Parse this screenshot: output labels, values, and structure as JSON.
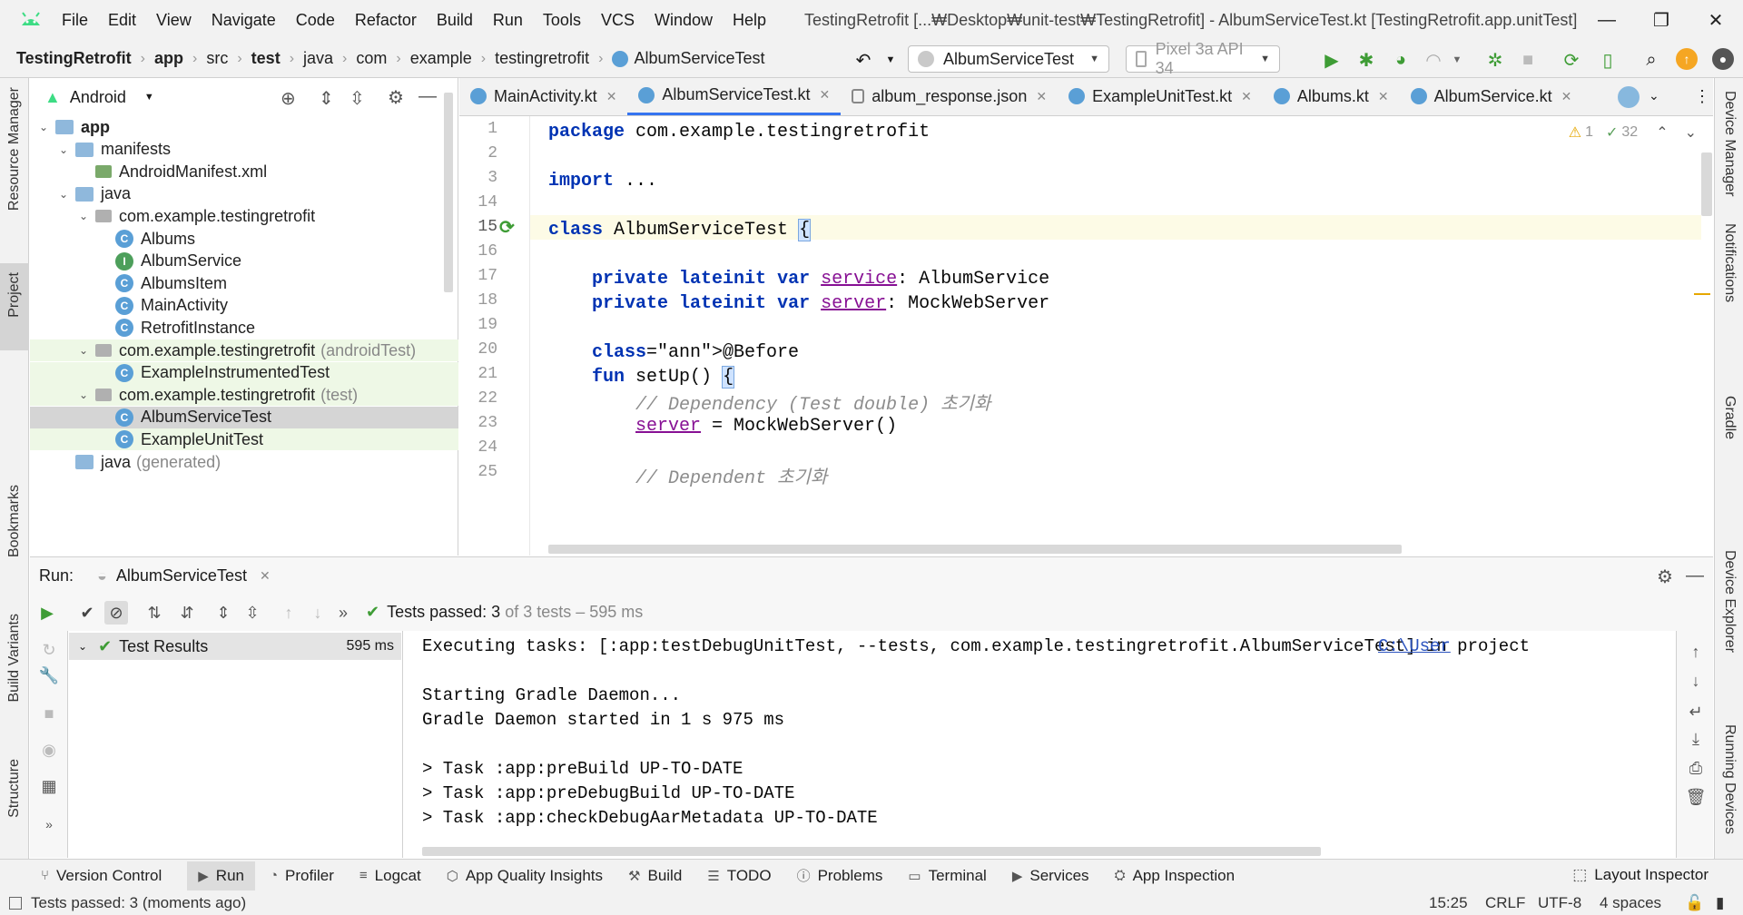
{
  "app": {
    "title": "TestingRetrofit [...₩Desktop₩unit-test₩TestingRetrofit] - AlbumServiceTest.kt [TestingRetrofit.app.unitTest]"
  },
  "menu": [
    "File",
    "Edit",
    "View",
    "Navigate",
    "Code",
    "Refactor",
    "Build",
    "Run",
    "Tools",
    "VCS",
    "Window",
    "Help"
  ],
  "breadcrumb": [
    "TestingRetrofit",
    "app",
    "src",
    "test",
    "java",
    "com",
    "example",
    "testingretrofit",
    "AlbumServiceTest"
  ],
  "run_config": "AlbumServiceTest",
  "device": "Pixel 3a API 34",
  "left_strip": [
    "Resource Manager",
    "Project",
    "Bookmarks",
    "Build Variants",
    "Structure"
  ],
  "right_strip": [
    "Device Manager",
    "Notifications",
    "Gradle",
    "Device Explorer",
    "Running Devices"
  ],
  "project_panel": {
    "view": "Android",
    "tree": [
      {
        "label": "app",
        "bold": true,
        "level": 0,
        "type": "module",
        "expanded": true
      },
      {
        "label": "manifests",
        "level": 1,
        "type": "folder",
        "expanded": true
      },
      {
        "label": "AndroidManifest.xml",
        "level": 2,
        "type": "manifest"
      },
      {
        "label": "java",
        "level": 1,
        "type": "folder",
        "expanded": true
      },
      {
        "label": "com.example.testingretrofit",
        "level": 2,
        "type": "package",
        "expanded": true
      },
      {
        "label": "Albums",
        "level": 3,
        "type": "class"
      },
      {
        "label": "AlbumService",
        "level": 3,
        "type": "interface"
      },
      {
        "label": "AlbumsItem",
        "level": 3,
        "type": "class"
      },
      {
        "label": "MainActivity",
        "level": 3,
        "type": "class"
      },
      {
        "label": "RetrofitInstance",
        "level": 3,
        "type": "class"
      },
      {
        "label": "com.example.testingretrofit",
        "suffix": "(androidTest)",
        "level": 2,
        "type": "package",
        "expanded": true,
        "green": true
      },
      {
        "label": "ExampleInstrumentedTest",
        "level": 3,
        "type": "class",
        "green": true
      },
      {
        "label": "com.example.testingretrofit",
        "suffix": "(test)",
        "level": 2,
        "type": "package",
        "expanded": true,
        "green": true
      },
      {
        "label": "AlbumServiceTest",
        "level": 3,
        "type": "class",
        "selected": true
      },
      {
        "label": "ExampleUnitTest",
        "level": 3,
        "type": "class",
        "green": true
      },
      {
        "label": "java",
        "suffix": "(generated)",
        "level": 1,
        "type": "genfolder"
      }
    ]
  },
  "editor_tabs": [
    {
      "label": "MainActivity.kt",
      "active": false
    },
    {
      "label": "AlbumServiceTest.kt",
      "active": true
    },
    {
      "label": "album_response.json",
      "active": false
    },
    {
      "label": "ExampleUnitTest.kt",
      "active": false
    },
    {
      "label": "Albums.kt",
      "active": false
    },
    {
      "label": "AlbumService.kt",
      "active": false
    }
  ],
  "inspections": {
    "warnings": "1",
    "weak": "32"
  },
  "code_lines": [
    {
      "n": "1",
      "t": "package com.example.testingretrofit"
    },
    {
      "n": "2",
      "t": ""
    },
    {
      "n": "3",
      "t": "import ..."
    },
    {
      "n": "14",
      "t": ""
    },
    {
      "n": "15",
      "t": "class AlbumServiceTest {"
    },
    {
      "n": "16",
      "t": ""
    },
    {
      "n": "17",
      "t": "    private lateinit var service: AlbumService"
    },
    {
      "n": "18",
      "t": "    private lateinit var server: MockWebServer"
    },
    {
      "n": "19",
      "t": ""
    },
    {
      "n": "20",
      "t": "    @Before"
    },
    {
      "n": "21",
      "t": "    fun setUp() {"
    },
    {
      "n": "22",
      "t": "        // Dependency (Test double) 초기화"
    },
    {
      "n": "23",
      "t": "        server = MockWebServer()"
    },
    {
      "n": "24",
      "t": ""
    },
    {
      "n": "25",
      "t": "        // Dependent 초기화"
    }
  ],
  "run": {
    "label": "Run:",
    "config": "AlbumServiceTest",
    "status_prefix": "Tests passed:",
    "passed": "3",
    "status_suffix": "of 3 tests – 595 ms",
    "tree": {
      "label": "Test Results",
      "time": "595 ms"
    },
    "console": [
      "Executing tasks: [:app:testDebugUnitTest, --tests, com.example.testingretrofit.AlbumServiceTest] in project ",
      "",
      "Starting Gradle Daemon...",
      "Gradle Daemon started in 1 s 975 ms",
      "",
      "> Task :app:preBuild UP-TO-DATE",
      "> Task :app:preDebugBuild UP-TO-DATE",
      "> Task :app:checkDebugAarMetadata UP-TO-DATE"
    ],
    "console_link": "C:\\User"
  },
  "tool_windows": [
    "Version Control",
    "Run",
    "Profiler",
    "Logcat",
    "App Quality Insights",
    "Build",
    "TODO",
    "Problems",
    "Terminal",
    "Services",
    "App Inspection"
  ],
  "layout_inspector": "Layout Inspector",
  "status": {
    "message": "Tests passed: 3 (moments ago)",
    "position": "15:25",
    "line_sep": "CRLF",
    "encoding": "UTF-8",
    "indent": "4 spaces"
  }
}
